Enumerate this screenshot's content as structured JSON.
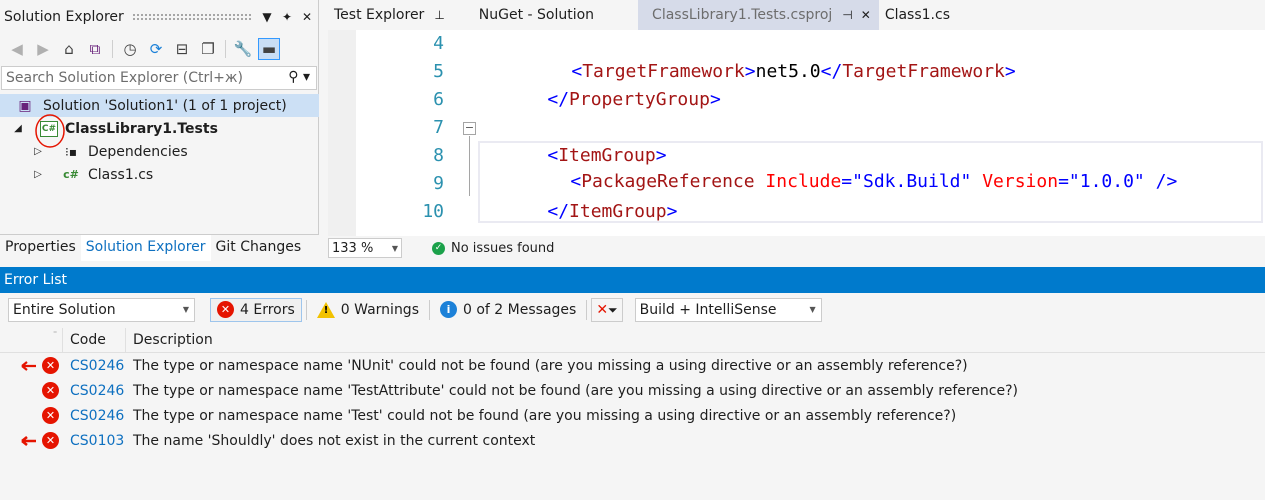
{
  "solution_explorer": {
    "title": "Solution Explorer",
    "search_placeholder": "Search Solution Explorer (Ctrl+ж)",
    "tree": [
      {
        "label": "Solution 'Solution1' (1 of 1 project)"
      },
      {
        "label": "ClassLibrary1.Tests"
      },
      {
        "label": "Dependencies"
      },
      {
        "label": "Class1.cs"
      }
    ],
    "bottom_tabs": [
      "Properties",
      "Solution Explorer",
      "Git Changes"
    ],
    "project_icon_text": "C#",
    "file_icon_text": "c#"
  },
  "doc_tabs": [
    {
      "label": "Test Explorer"
    },
    {
      "label": "NuGet - Solution"
    },
    {
      "label": "ClassLibrary1.Tests.csproj"
    },
    {
      "label": "Class1.cs"
    }
  ],
  "editor": {
    "line_numbers": [
      "4",
      "5",
      "6",
      "7",
      "8",
      "9",
      "10"
    ],
    "lines": {
      "l4": {
        "open": "<",
        "tag": "TargetFramework",
        "close": ">",
        "text": "net5.0",
        "open2": "</",
        "tag2": "TargetFramework",
        "close2": ">"
      },
      "l5": {
        "open": "</",
        "tag": "PropertyGroup",
        "close": ">"
      },
      "l7": {
        "open": "<",
        "tag": "ItemGroup",
        "close": ">"
      },
      "l8": {
        "open": "<",
        "tag": "PackageReference",
        "attr1": " Include",
        "eq1": "=",
        "val1": "\"Sdk.Build\"",
        "attr2": " Version",
        "eq2": "=",
        "val2": "\"1.0.0\"",
        "end": " />"
      },
      "l9": {
        "open": "</",
        "tag": "ItemGroup",
        "close": ">"
      }
    },
    "zoom": "133 %",
    "status": "No issues found"
  },
  "error_list": {
    "title": "Error List",
    "scope": "Entire Solution",
    "errors_label": "4 Errors",
    "warnings_label": "0 Warnings",
    "messages_label": "0 of 2 Messages",
    "build_filter": "Build + IntelliSense",
    "columns": {
      "code": "Code",
      "description": "Description"
    },
    "rows": [
      {
        "code": "CS0246",
        "description": "The type or namespace name 'NUnit' could not be found (are you missing a using directive or an assembly reference?)"
      },
      {
        "code": "CS0246",
        "description": "The type or namespace name 'TestAttribute' could not be found (are you missing a using directive or an assembly reference?)"
      },
      {
        "code": "CS0246",
        "description": "The type or namespace name 'Test' could not be found (are you missing a using directive or an assembly reference?)"
      },
      {
        "code": "CS0103",
        "description": "The name 'Shouldly' does not exist in the current context"
      }
    ]
  },
  "colors": {
    "accent": "#007acc",
    "error": "#e51400",
    "link": "#0e70c0",
    "selection": "#cce0f5"
  }
}
